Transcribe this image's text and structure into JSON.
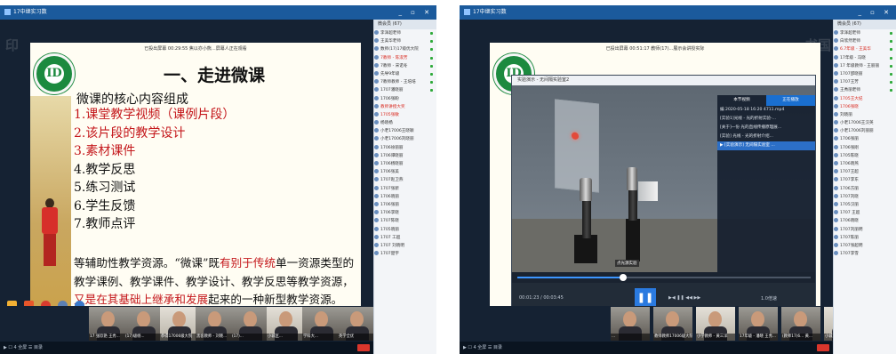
{
  "left": {
    "window_title": "17中继实习数",
    "watermark": "印",
    "slide": {
      "top_banner": "已投出屏幕   00:29:55   焦以亦小熊...屏幕人正在观看",
      "title": "一、走进微课",
      "heading": "微课的核心内容组成",
      "items": [
        {
          "text": "1.课堂教学视频（课例片段）",
          "red": true
        },
        {
          "text": "2.该片段的教学设计",
          "red": true
        },
        {
          "text": "3.素材课件",
          "red": true
        },
        {
          "text": "4.教学反思",
          "red": false
        },
        {
          "text": "5.练习测试",
          "red": false
        },
        {
          "text": "6.学生反馈",
          "red": false
        },
        {
          "text": "7.教师点评",
          "red": false
        }
      ],
      "para_1": "等辅助性教学资源。“微课”既",
      "para_red_1": "有别于传统",
      "para_2": "单一资源类型的教学课例、教学课件、教学设计、教学反思等教学资源，",
      "para_red_2": "又是在其基础上继承和发展",
      "para_3": "起来的一种新型教学资源。"
    },
    "sidebar_header": "微会员 (67)",
    "sidebar": [
      {
        "label": "李泽超老师",
        "red": false
      },
      {
        "label": "王美华老师",
        "red": false
      },
      {
        "label": "数师(17)17级优大院",
        "red": false
      },
      {
        "label": "7教师 - 陈淑芳",
        "red": true
      },
      {
        "label": "7教师 - 宋诺冬",
        "red": false
      },
      {
        "label": "先导9年级",
        "red": false
      },
      {
        "label": "7教师教师 - 王培培",
        "red": false
      },
      {
        "label": "1707潘晓丽",
        "red": false
      },
      {
        "label": "1706张盼",
        "red": false
      },
      {
        "label": "教师讲授大奖",
        "red": true
      },
      {
        "label": "1705张敏",
        "red": true
      },
      {
        "label": "杨晓杨",
        "red": false
      },
      {
        "label": "小老17006王晓颖",
        "red": false
      },
      {
        "label": "小老17006刘晓丽",
        "red": false
      },
      {
        "label": "1706徐丽丽",
        "red": false
      },
      {
        "label": "1706谭晓丽",
        "red": false
      },
      {
        "label": "1706杨晓丽",
        "red": false
      },
      {
        "label": "1706张美",
        "red": false
      },
      {
        "label": "1707赵卫燕",
        "red": false
      },
      {
        "label": "1707张新",
        "red": false
      },
      {
        "label": "1706晓丽",
        "red": false
      },
      {
        "label": "1706张丽",
        "red": false
      },
      {
        "label": "1706李晓",
        "red": false
      },
      {
        "label": "1707陈晓",
        "red": false
      },
      {
        "label": "1705晓丽",
        "red": false
      },
      {
        "label": "1707 工超",
        "red": false
      },
      {
        "label": "1707 刘晓明",
        "red": false
      },
      {
        "label": "1707楚宇",
        "red": false
      }
    ],
    "thumbs": [
      "17 张欣艳 王秀...",
      "(17)级杨...",
      "恭得17006级大院",
      "黑客教师 - 刘晓...",
      "(17)...",
      "小城区...",
      "学科大...",
      "英学全优"
    ],
    "bottom_bar": "▶  ☐  4  全屏  ☰  目录",
    "status_right": "小17"
  },
  "right": {
    "window_title": "17中继实习数",
    "watermark": "书国",
    "top_banner": "已投出屏幕   00:51:17   教师(17)...展示会讲授实际",
    "player": {
      "title": "实验演示 - 无间隔实验室2",
      "tabs": [
        "本节视频",
        "正在播放"
      ],
      "active_tab": 1,
      "playlist": [
        "编 2020-05-18 16:20 4711.mp4",
        "[实验1]光线 - 光的折射实验-...",
        "[关于]一份 光的直线传播原理展...",
        "[实验] 光线 - 光的折射介绍...",
        "▶ [实验演示] 无间隔实验室 ..."
      ],
      "selected_index": 4,
      "scene_tag": "点光源实验",
      "progress": 0.36,
      "time_label": "00:01:23 / 00:03:45",
      "controls_text": "▶◀ ❚❚ ◀◀ ▶▶",
      "speed": "1.0倍速"
    },
    "sidebar_header": "微会员 (67)",
    "sidebar": [
      {
        "label": "李泽超老师",
        "red": false
      },
      {
        "label": "白欣然老师",
        "red": false
      },
      {
        "label": "6.7年级 - 王美华",
        "red": true
      },
      {
        "label": "17年级 - 冯晓",
        "red": false
      },
      {
        "label": "17 年级教师 - 王丽丽",
        "red": false
      },
      {
        "label": "1707邵晓丽",
        "red": false
      },
      {
        "label": "1707王芳",
        "red": false
      },
      {
        "label": "王秀丽老师",
        "red": false
      },
      {
        "label": "1705王大纪",
        "red": true
      },
      {
        "label": "1706张晓",
        "red": true
      },
      {
        "label": "刘晓丽",
        "red": false
      },
      {
        "label": "小老17006王汉英",
        "red": false
      },
      {
        "label": "小老17006刘丽丽",
        "red": false
      },
      {
        "label": "1706张丽",
        "red": false
      },
      {
        "label": "1706张刚",
        "red": false
      },
      {
        "label": "1705陈晓",
        "red": false
      },
      {
        "label": "1706晓燕",
        "red": false
      },
      {
        "label": "1707王超",
        "red": false
      },
      {
        "label": "1707李东",
        "red": false
      },
      {
        "label": "1706方丽",
        "red": false
      },
      {
        "label": "1707刘晓",
        "red": false
      },
      {
        "label": "1705汉丽",
        "red": false
      },
      {
        "label": "1707 王超",
        "red": false
      },
      {
        "label": "1706晓晓",
        "red": false
      },
      {
        "label": "1707刘丽明",
        "red": false
      },
      {
        "label": "1707陈丽",
        "red": false
      },
      {
        "label": "1707张超明",
        "red": false
      },
      {
        "label": "1707李雪",
        "red": false
      }
    ],
    "thumbs": [
      "...",
      "教师教师17006级大院",
      "小学教师 - 黄三洋",
      "17年级 - 潘晓 王秀...",
      "(教师17)6... 黄...",
      "小城区"
    ],
    "bottom_bar": "▶  ☐  4  全屏  ☰  目录"
  }
}
